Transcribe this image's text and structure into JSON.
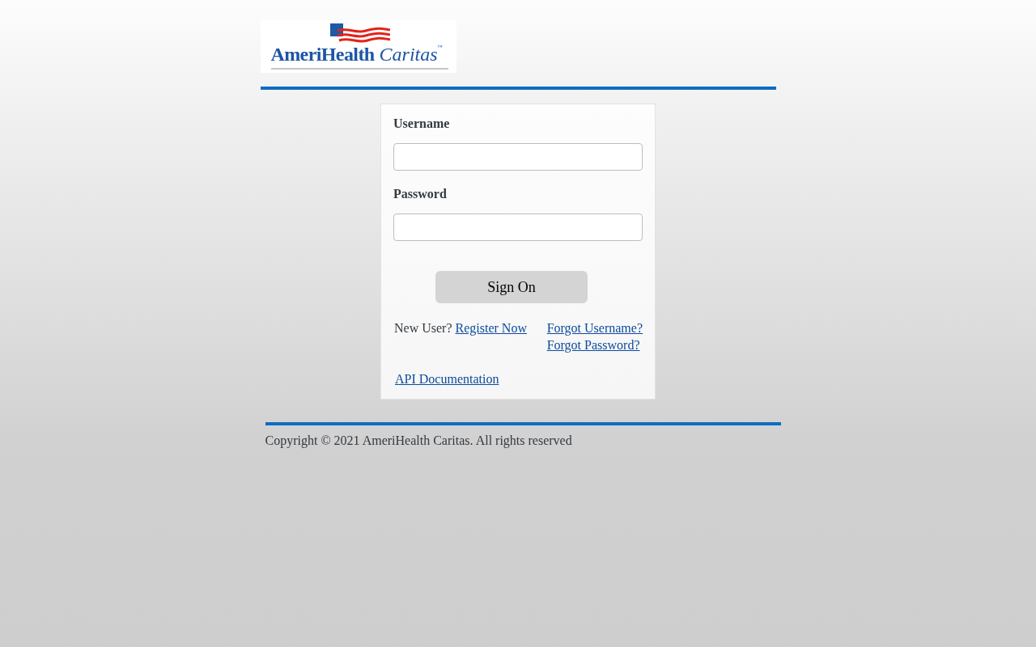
{
  "logo": {
    "name": "AmeriHealth",
    "name_italic": "Caritas",
    "trademark": "™"
  },
  "form": {
    "fields": [
      {
        "label": "Username"
      },
      {
        "label": "Password"
      }
    ],
    "submit": "Sign On",
    "register": {
      "prompt": "New User?",
      "link": "Register Now"
    },
    "recovery_links": [
      "Forgot Username?",
      "Forgot Password?"
    ],
    "api_link": "API Documentation"
  },
  "footer": {
    "copyright": "Copyright © 2021 AmeriHealth Caritas. All rights reserved"
  }
}
